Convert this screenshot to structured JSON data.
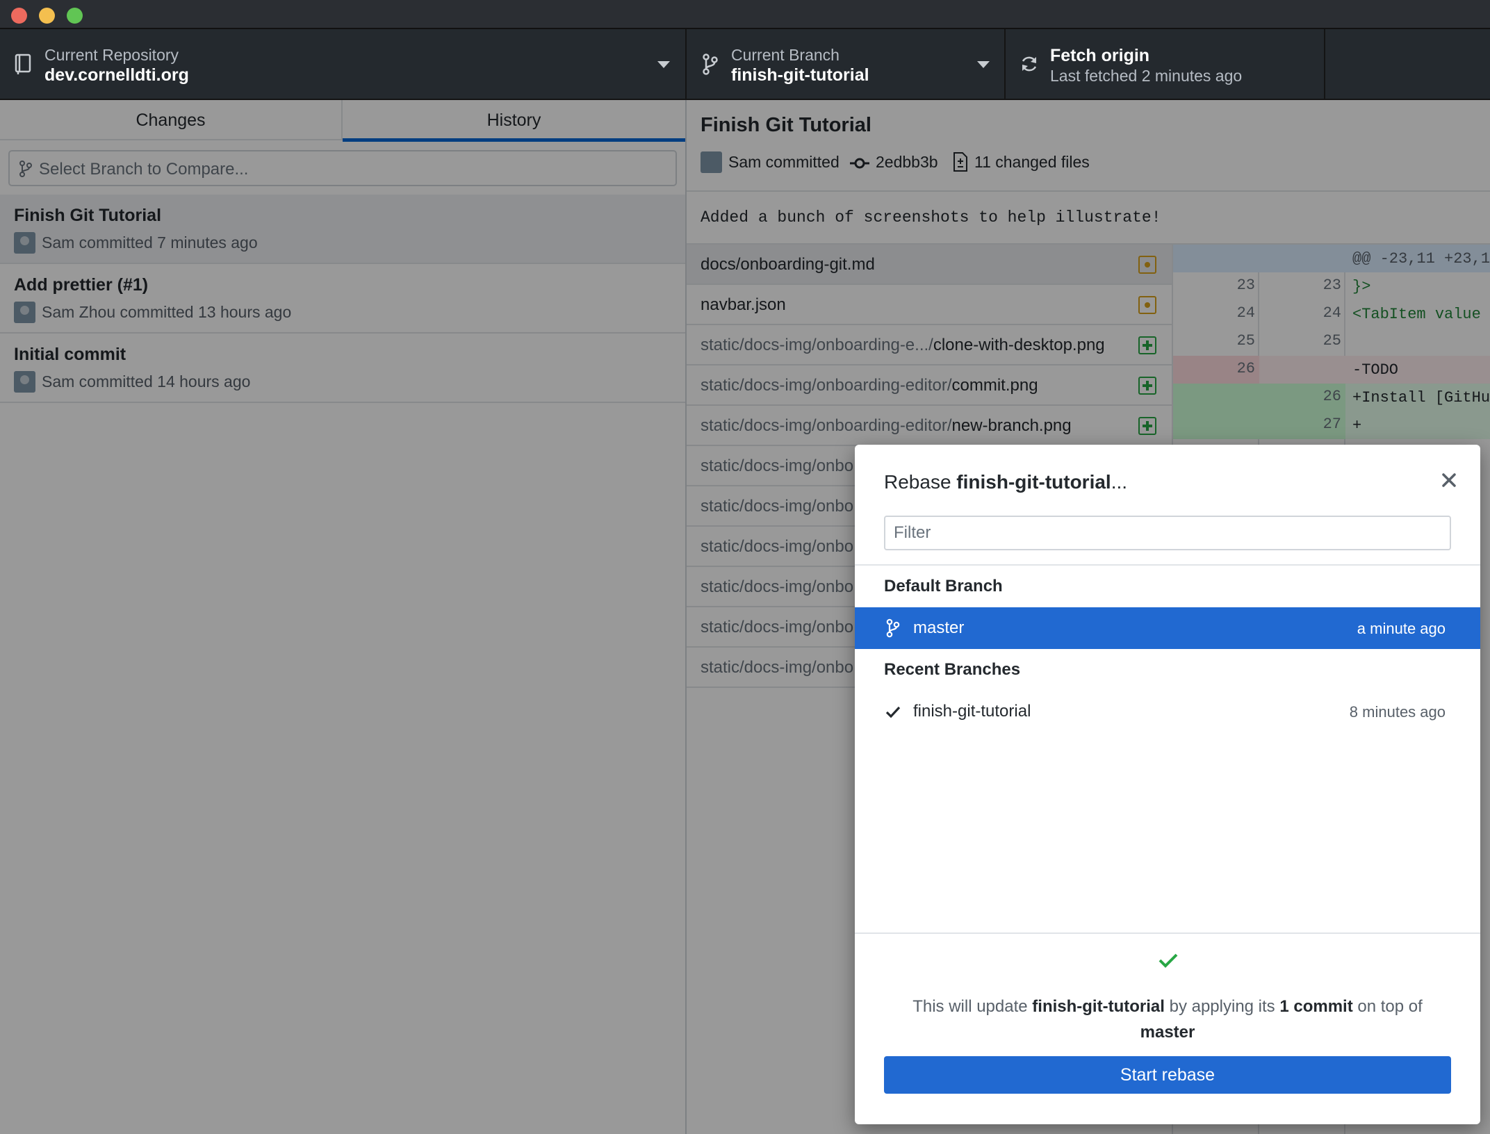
{
  "toolbar": {
    "repo_label": "Current Repository",
    "repo_name": "dev.cornelldti.org",
    "branch_label": "Current Branch",
    "branch_name": "finish-git-tutorial",
    "fetch_title": "Fetch origin",
    "fetch_status": "Last fetched 2 minutes ago"
  },
  "sidebar": {
    "tabs": [
      "Changes",
      "History"
    ],
    "active_tab": "History",
    "compare_placeholder": "Select Branch to Compare...",
    "commits": [
      {
        "title": "Finish Git Tutorial",
        "subtitle": "Sam committed 7 minutes ago"
      },
      {
        "title": "Add prettier (#1)",
        "subtitle": "Sam Zhou committed 13 hours ago"
      },
      {
        "title": "Initial commit",
        "subtitle": "Sam committed 14 hours ago"
      }
    ]
  },
  "detail": {
    "title": "Finish Git Tutorial",
    "author": "Sam committed",
    "sha": "2edbb3b",
    "changed_files": "11 changed files",
    "summary": "Added a bunch of screenshots to help illustrate!",
    "files": [
      {
        "dir": "",
        "name": "docs/onboarding-git.md",
        "status": "modified"
      },
      {
        "dir": "",
        "name": "navbar.json",
        "status": "modified"
      },
      {
        "dir": "static/docs-img/onboarding-e.../",
        "name": "clone-with-desktop.png",
        "status": "added"
      },
      {
        "dir": "static/docs-img/onboarding-editor/",
        "name": "commit.png",
        "status": "added"
      },
      {
        "dir": "static/docs-img/onboarding-editor/",
        "name": "new-branch.png",
        "status": "added"
      },
      {
        "dir": "static/docs-img/onbo",
        "name": "",
        "status": "added"
      },
      {
        "dir": "static/docs-img/onbo",
        "name": "",
        "status": "added"
      },
      {
        "dir": "static/docs-img/onbo",
        "name": "",
        "status": "added"
      },
      {
        "dir": "static/docs-img/onbo",
        "name": "",
        "status": "added"
      },
      {
        "dir": "static/docs-img/onbo",
        "name": "",
        "status": "added"
      },
      {
        "dir": "static/docs-img/onbo",
        "name": "",
        "status": "added"
      }
    ],
    "diff": [
      {
        "type": "hunk",
        "old": "",
        "new": "",
        "code": "@@ -23,11 +23,1"
      },
      {
        "type": "ctx",
        "old": "23",
        "new": "23",
        "code": " }>"
      },
      {
        "type": "ctx",
        "old": "24",
        "new": "24",
        "code": " <TabItem value"
      },
      {
        "type": "ctx",
        "old": "25",
        "new": "25",
        "code": ""
      },
      {
        "type": "del",
        "old": "26",
        "new": "",
        "code": "-TODO"
      },
      {
        "type": "add",
        "old": "",
        "new": "26",
        "code": "+Install [GitHu"
      },
      {
        "type": "add",
        "old": "",
        "new": "27",
        "code": "+"
      }
    ]
  },
  "dialog": {
    "title_prefix": "Rebase ",
    "title_branch": "finish-git-tutorial",
    "title_suffix": "...",
    "filter_placeholder": "Filter",
    "default_group": "Default Branch",
    "default_branch": {
      "name": "master",
      "time": "a minute ago"
    },
    "recent_group": "Recent Branches",
    "recent_branch": {
      "name": "finish-git-tutorial",
      "time": "8 minutes ago"
    },
    "message": {
      "p1": "This will update ",
      "branch": "finish-git-tutorial",
      "p2": " by applying its ",
      "count": "1 commit",
      "p3": " on top of ",
      "base": "master"
    },
    "button_label": "Start rebase"
  },
  "colors": {
    "accent": "#2169d1",
    "toolbar_bg": "#24292e",
    "added": "#28a745",
    "modified": "#d9a21b"
  },
  "icons": [
    "repo-icon",
    "branch-icon",
    "sync-icon",
    "commit-icon",
    "file-diff-icon",
    "close-icon",
    "check-icon"
  ]
}
